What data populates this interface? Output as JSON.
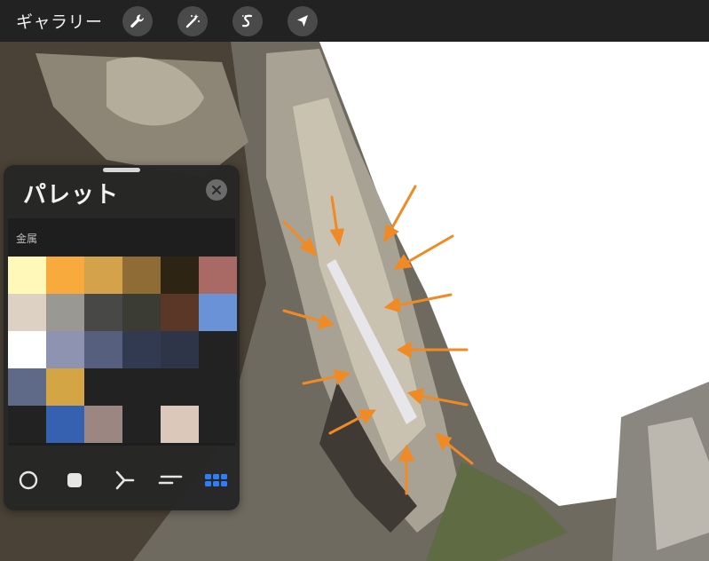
{
  "topbar": {
    "gallery_label": "ギャラリー",
    "tools": [
      {
        "name": "wrench-icon"
      },
      {
        "name": "magic-wand-icon"
      },
      {
        "name": "selection-icon"
      },
      {
        "name": "transform-arrow-icon"
      }
    ]
  },
  "palette_panel": {
    "title": "パレット",
    "palette_name": "金属",
    "close_icon": "close-icon",
    "swatches": [
      "#fff8b8",
      "#f9aa3c",
      "#d3a24a",
      "#8f6c35",
      "#2d2414",
      "#a96a66",
      "#dcd1c2",
      "#9a9892",
      "#484946",
      "#3b3d35",
      "#5a3727",
      "#6a92d6",
      "#ffffff",
      "#8e93b2",
      "#565f7d",
      "#323a52",
      "#2f3549",
      "#222222",
      "#5e6a88",
      "#d4a545",
      "#222222",
      "#222222",
      "#222222",
      "#222222",
      "#222222",
      "#3660b0",
      "#9b8682",
      "#222222",
      "#dcc8bb",
      "#222222"
    ],
    "tabs": [
      {
        "name": "color-disc-tab-icon",
        "active": false
      },
      {
        "name": "classic-tab-icon",
        "active": false
      },
      {
        "name": "harmony-tab-icon",
        "active": false
      },
      {
        "name": "value-tab-icon",
        "active": false
      },
      {
        "name": "palettes-tab-icon",
        "active": true
      }
    ],
    "active_color": "#2f7ef5"
  },
  "canvas": {
    "arrow_color": "#f08a24",
    "background_color": "#ffffff"
  }
}
